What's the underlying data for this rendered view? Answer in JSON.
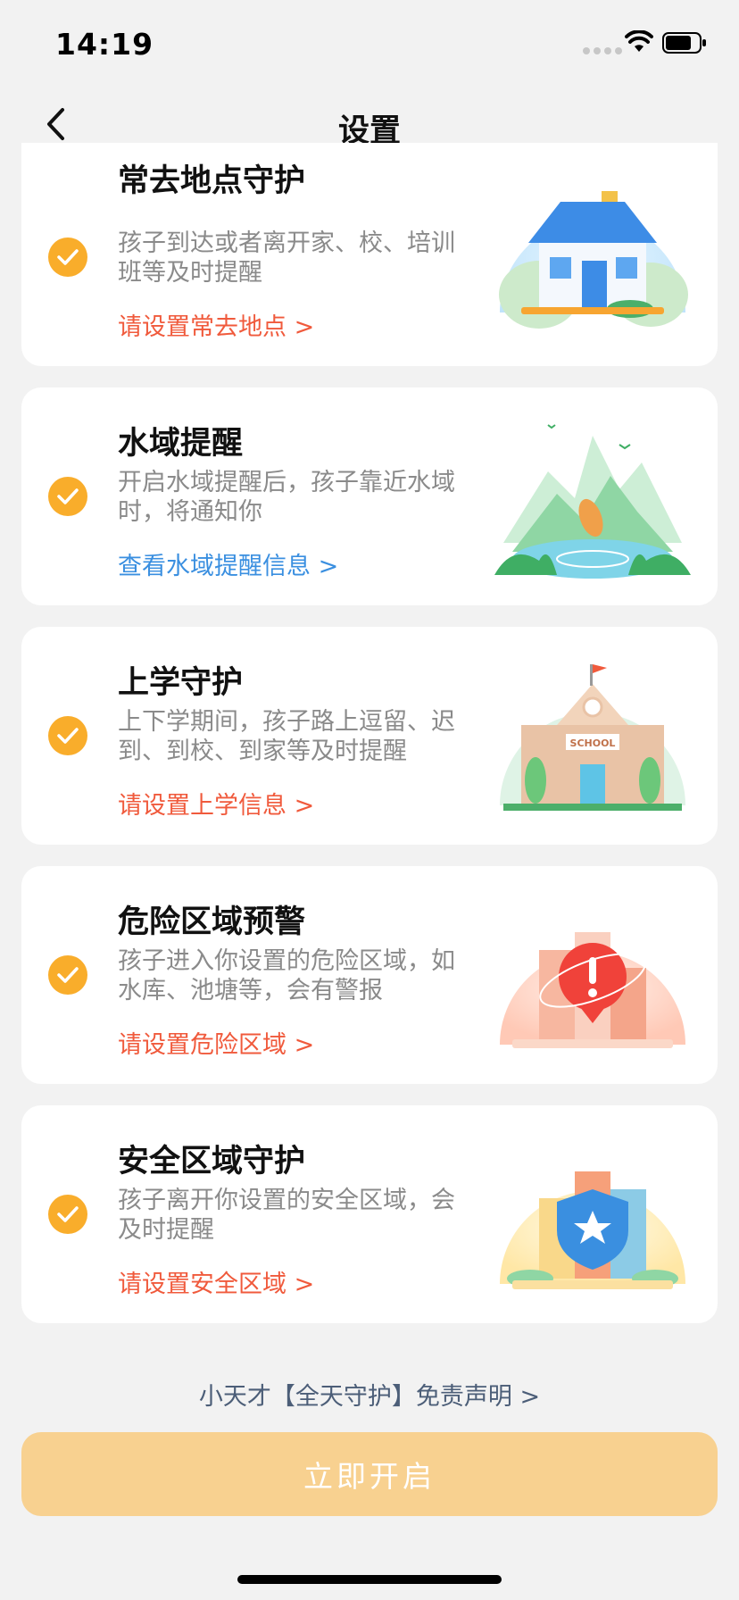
{
  "status_bar": {
    "time": "14:19"
  },
  "nav": {
    "title": "设置"
  },
  "cards": [
    {
      "title": "常去地点守护",
      "desc": "孩子到达或者离开家、校、培训班等及时提醒",
      "link": "请设置常去地点 >",
      "illustration": "house-illustration"
    },
    {
      "title": "水域提醒",
      "desc": "开启水域提醒后，孩子靠近水域时，将通知你",
      "link": "查看水域提醒信息 >",
      "illustration": "water-fish-illustration"
    },
    {
      "title": "上学守护",
      "desc": "上下学期间，孩子路上逗留、迟到、到校、到家等及时提醒",
      "link": "请设置上学信息 >",
      "illustration": "school-illustration",
      "sign": "SCHOOL"
    },
    {
      "title": "危险区域预警",
      "desc": "孩子进入你设置的危险区域，如水库、池塘等，会有警报",
      "link": "请设置危险区域 >",
      "illustration": "danger-alert-illustration"
    },
    {
      "title": "安全区域守护",
      "desc": "孩子离开你设置的安全区域，会及时提醒",
      "link": "请设置安全区域 >",
      "illustration": "safety-shield-illustration"
    }
  ],
  "disclaimer": "小天才【全天守护】免责声明 >",
  "primary_button": "立即开启",
  "colors": {
    "check": "#f9ad2b",
    "link_red": "#f05a3c",
    "link_blue": "#3a8fe0",
    "button": "#f8d190"
  }
}
